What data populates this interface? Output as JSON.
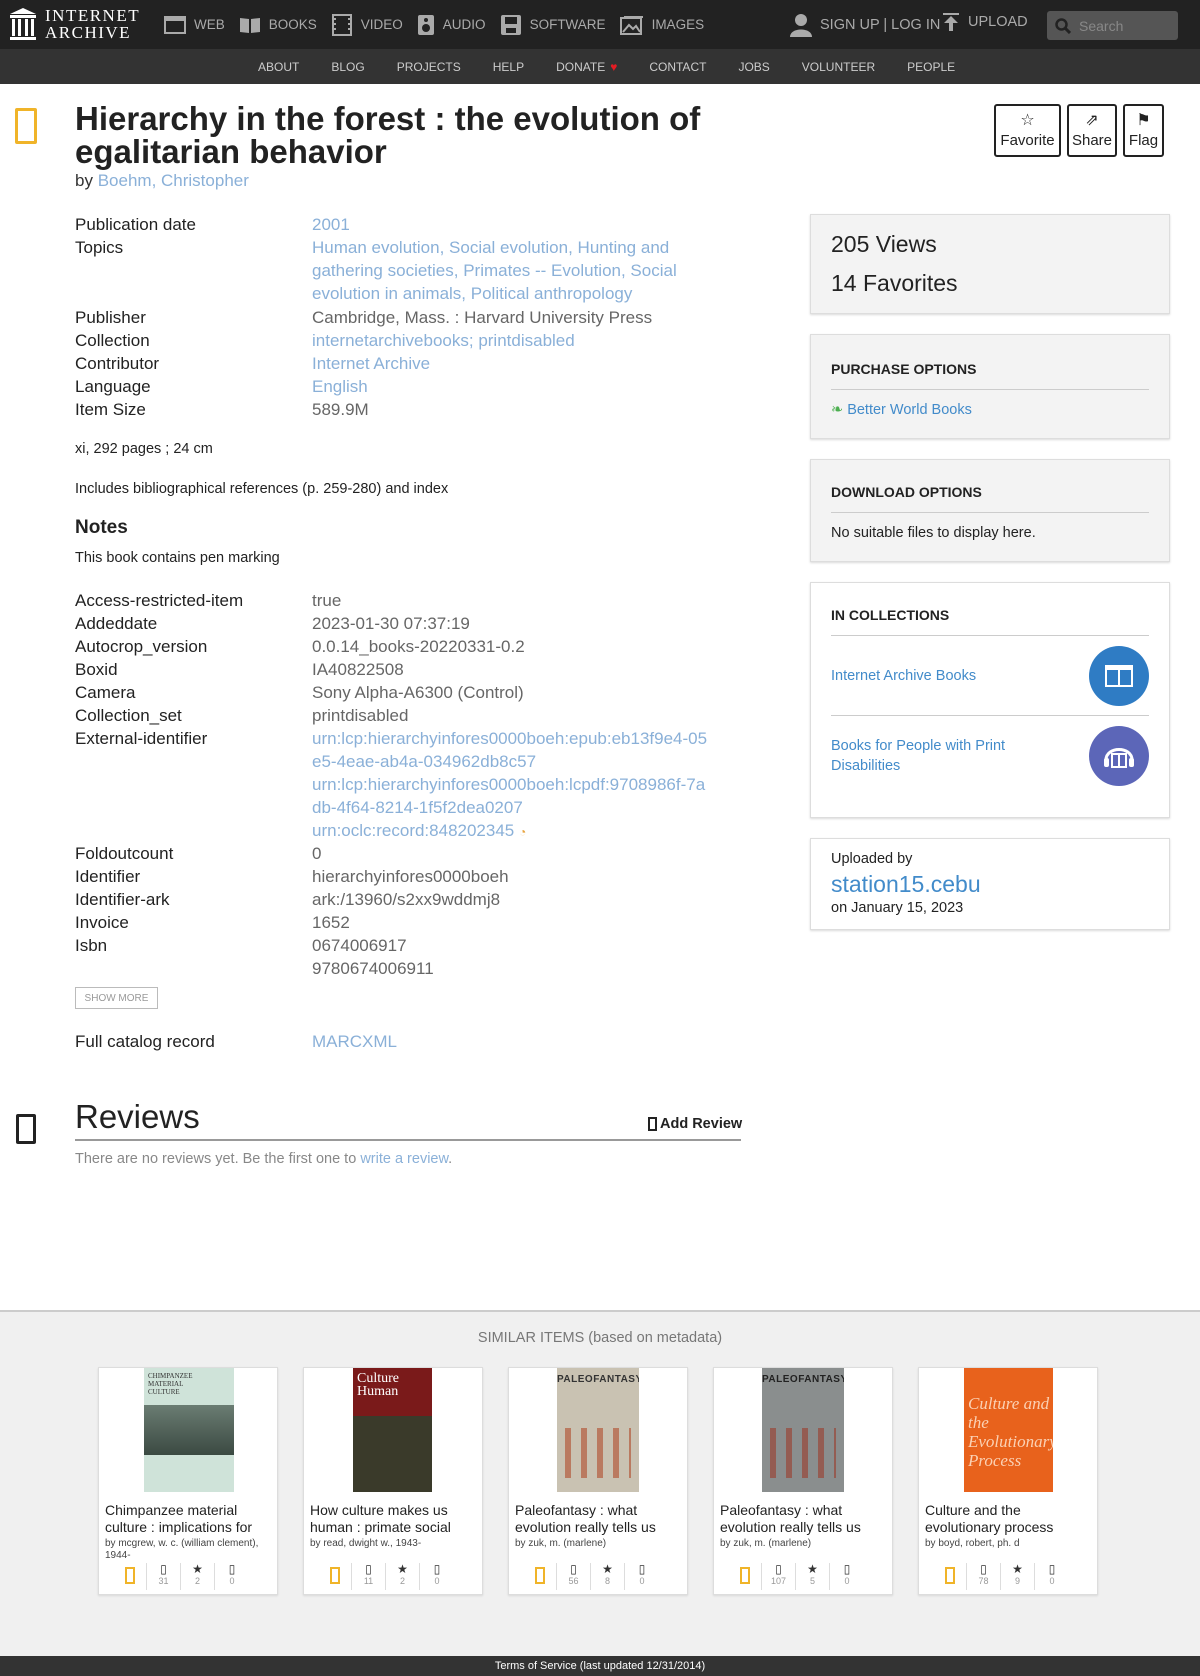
{
  "nav": {
    "logo_line1": "INTERNET",
    "logo_line2": "ARCHIVE",
    "media": [
      "WEB",
      "BOOKS",
      "VIDEO",
      "AUDIO",
      "SOFTWARE",
      "IMAGES"
    ],
    "signup": "SIGN UP | LOG IN",
    "upload": "UPLOAD",
    "search_placeholder": "Search"
  },
  "subnav": [
    "ABOUT",
    "BLOG",
    "PROJECTS",
    "HELP",
    "DONATE",
    "CONTACT",
    "JOBS",
    "VOLUNTEER",
    "PEOPLE"
  ],
  "item": {
    "title": "Hierarchy in the forest : the evolution of egalitarian behavior",
    "by_prefix": "by",
    "author": "Boehm, Christopher"
  },
  "actions": {
    "favorite": "Favorite",
    "share": "Share",
    "flag": "Flag"
  },
  "metadata": {
    "pub_date_key": "Publication date",
    "pub_date": "2001",
    "topics_key": "Topics",
    "topics": "Human evolution, Social evolution, Hunting and gathering societies, Primates -- Evolution, Social evolution in animals, Political anthropology",
    "publisher_key": "Publisher",
    "publisher": "Cambridge, Mass. : Harvard University Press",
    "collection_key": "Collection",
    "collection": "internetarchivebooks; printdisabled",
    "contributor_key": "Contributor",
    "contributor": "Internet Archive",
    "language_key": "Language",
    "language": "English",
    "item_size_key": "Item Size",
    "item_size": "589.9M"
  },
  "description": {
    "pages": "xi, 292 pages ; 24 cm",
    "refs": "Includes bibliographical references (p. 259-280) and index",
    "notes_heading": "Notes",
    "notes_text": "This book contains pen marking"
  },
  "extra_meta": {
    "access_key": "Access-restricted-item",
    "access": "true",
    "addeddate_key": "Addeddate",
    "addeddate": "2023-01-30 07:37:19",
    "autocrop_key": "Autocrop_version",
    "autocrop": "0.0.14_books-20220331-0.2",
    "boxid_key": "Boxid",
    "boxid": "IA40822508",
    "camera_key": "Camera",
    "camera": "Sony Alpha-A6300 (Control)",
    "collection_set_key": "Collection_set",
    "collection_set": "printdisabled",
    "external_id_key": "External-identifier",
    "external_id_1": "urn:lcp:hierarchyinfores0000boeh:epub:eb13f9e4-05e5-4eae-ab4a-034962db8c57",
    "external_id_2": "urn:lcp:hierarchyinfores0000boeh:lcpdf:9708986f-7adb-4f64-8214-1f5f2dea0207",
    "external_id_3": "urn:oclc:record:848202345",
    "foldout_key": "Foldoutcount",
    "foldout": "0",
    "identifier_key": "Identifier",
    "identifier": "hierarchyinfores0000boeh",
    "ark_key": "Identifier-ark",
    "ark": "ark:/13960/s2xx9wddmj8",
    "invoice_key": "Invoice",
    "invoice": "1652",
    "isbn_key": "Isbn",
    "isbn_1": "0674006917",
    "isbn_2": "9780674006911"
  },
  "show_more": "SHOW MORE",
  "catalog": {
    "key": "Full catalog record",
    "value": "MARCXML"
  },
  "stats": {
    "views": "205 Views",
    "favorites": "14 Favorites"
  },
  "purchase": {
    "heading": "PURCHASE OPTIONS",
    "bwb": "Better World Books"
  },
  "download": {
    "heading": "DOWNLOAD OPTIONS",
    "text": "No suitable files to display here."
  },
  "collections": {
    "heading": "IN COLLECTIONS",
    "items": [
      {
        "name": "Internet Archive Books",
        "color": "#2f7cc4"
      },
      {
        "name": "Books for People with Print Disabilities",
        "color": "#5c66b8"
      }
    ]
  },
  "uploader": {
    "label": "Uploaded by",
    "name": "station15.cebu",
    "date": "on January 15, 2023"
  },
  "reviews": {
    "heading": "Reviews",
    "add": "Add Review",
    "none_prefix": "There are no reviews yet. Be the first one to",
    "none_link": "write a review",
    "none_suffix": "."
  },
  "similar": {
    "heading": "SIMILAR ITEMS (based on metadata)",
    "items": [
      {
        "title": "Chimpanzee material culture : implications for",
        "by": "by mcgrew, w. c. (william clement), 1944-",
        "views": "31",
        "favs": "2",
        "reviews": "0",
        "cover_text": "CHIMPANZEE MATERIAL CULTURE"
      },
      {
        "title": "How culture makes us human : primate social",
        "by": "by read, dwight w., 1943-",
        "views": "11",
        "favs": "2",
        "reviews": "0",
        "cover_text": "Culture Human"
      },
      {
        "title": "Paleofantasy : what evolution really tells us",
        "by": "by zuk, m. (marlene)",
        "views": "56",
        "favs": "8",
        "reviews": "0",
        "cover_text": "PALEOFANTASY"
      },
      {
        "title": "Paleofantasy : what evolution really tells us",
        "by": "by zuk, m. (marlene)",
        "views": "107",
        "favs": "5",
        "reviews": "0",
        "cover_text": "PALEOFANTASY"
      },
      {
        "title": "Culture and the evolutionary process",
        "by": "by boyd, robert, ph. d",
        "views": "78",
        "favs": "9",
        "reviews": "0",
        "cover_text": "Culture and the Evolutionary Process"
      }
    ]
  },
  "footer": "Terms of Service (last updated 12/31/2014)"
}
